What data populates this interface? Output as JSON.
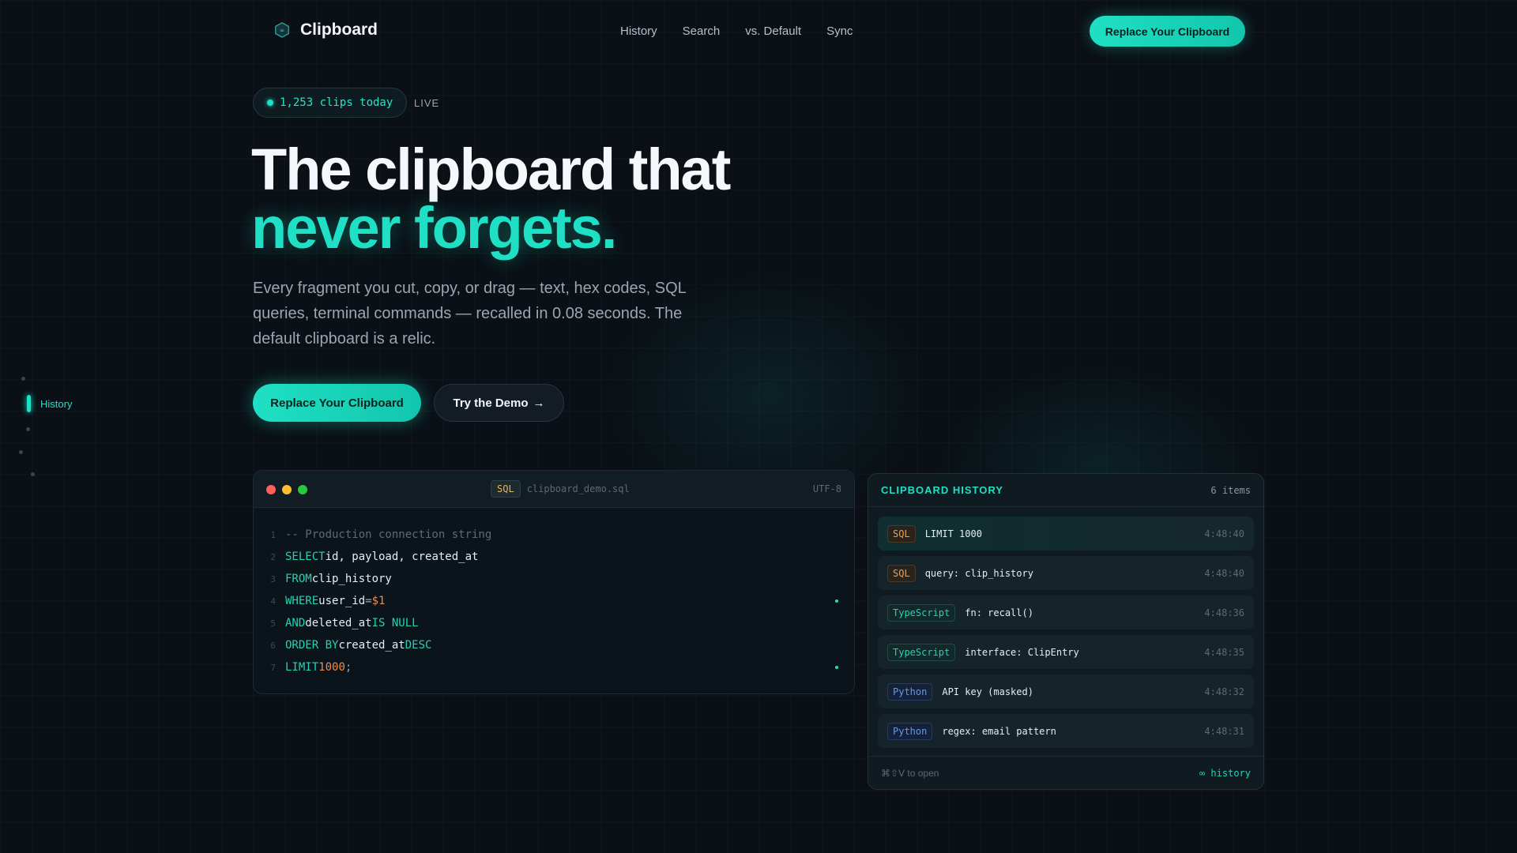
{
  "brand": {
    "name": "Clipboard"
  },
  "nav": {
    "links": [
      "History",
      "Search",
      "vs. Default",
      "Sync"
    ],
    "cta": "Replace Your Clipboard"
  },
  "status": {
    "count_text": "1,253 clips today",
    "live": "LIVE"
  },
  "hero": {
    "line1": "The clipboard that",
    "line2": "never forgets.",
    "subtitle": "Every fragment you cut, copy, or drag — text, hex codes, SQL queries, terminal commands — recalled in 0.08 seconds. The default clipboard is a relic.",
    "primary_cta": "Replace Your Clipboard",
    "secondary_cta": "Try the Demo",
    "secondary_arrow": "→"
  },
  "side_nav": {
    "active_label": "History"
  },
  "code_panel": {
    "lang_tag": "SQL",
    "filename": "clipboard_demo.sql",
    "encoding": "UTF-8",
    "lines": [
      {
        "n": "1",
        "parts": [
          [
            "cm",
            "-- Production connection string"
          ]
        ]
      },
      {
        "n": "2",
        "parts": [
          [
            "kw",
            "SELECT"
          ],
          [
            "tx",
            "id, payload, created_at"
          ]
        ]
      },
      {
        "n": "3",
        "parts": [
          [
            "kw",
            "FROM"
          ],
          [
            "tx",
            "clip_history"
          ]
        ]
      },
      {
        "n": "4",
        "parts": [
          [
            "kw",
            "WHERE"
          ],
          [
            "tx",
            "user_id"
          ],
          [
            "op",
            "="
          ],
          [
            "nm",
            "$1"
          ]
        ],
        "mark": true
      },
      {
        "n": "5",
        "parts": [
          [
            "kw",
            "AND"
          ],
          [
            "tx",
            "deleted_at"
          ],
          [
            "kw",
            "IS NULL"
          ]
        ]
      },
      {
        "n": "6",
        "parts": [
          [
            "kw",
            "ORDER BY"
          ],
          [
            "tx",
            "created_at"
          ],
          [
            "kw",
            "DESC"
          ]
        ]
      },
      {
        "n": "7",
        "parts": [
          [
            "kw",
            "LIMIT"
          ],
          [
            "nm",
            "1000"
          ],
          [
            "op",
            ";"
          ]
        ],
        "mark": true
      }
    ]
  },
  "history": {
    "title": "CLIPBOARD HISTORY",
    "count": "6 items",
    "items": [
      {
        "tag": "SQL",
        "kind": "sql",
        "text": "LIMIT 1000",
        "time": "4:48:40",
        "active": true
      },
      {
        "tag": "SQL",
        "kind": "sql",
        "text": "query: clip_history",
        "time": "4:48:40"
      },
      {
        "tag": "TypeScript",
        "kind": "ts",
        "text": "fn: recall()",
        "time": "4:48:36"
      },
      {
        "tag": "TypeScript",
        "kind": "ts",
        "text": "interface: ClipEntry",
        "time": "4:48:35"
      },
      {
        "tag": "Python",
        "kind": "py",
        "text": "API key (masked)",
        "time": "4:48:32"
      },
      {
        "tag": "Python",
        "kind": "py",
        "text": "regex: email pattern",
        "time": "4:48:31"
      }
    ],
    "hint": "⌘⇧V to open",
    "link": "∞ history"
  },
  "colors": {
    "accent": "#1fe0c4",
    "background": "#0a1016"
  }
}
